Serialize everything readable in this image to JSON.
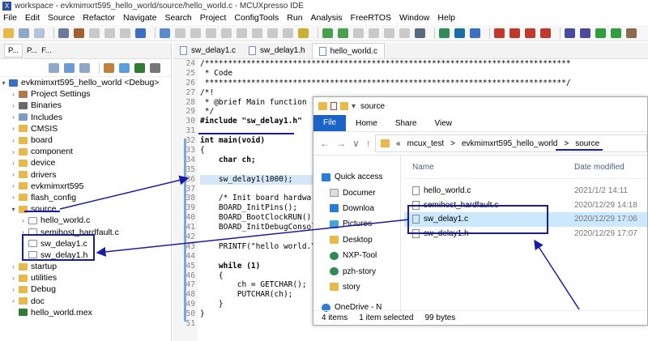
{
  "window": {
    "title": "workspace - evkmimxrt595_hello_world/source/hello_world.c - MCUXpresso IDE"
  },
  "menu": [
    "File",
    "Edit",
    "Source",
    "Refactor",
    "Navigate",
    "Search",
    "Project",
    "ConfigTools",
    "Run",
    "Analysis",
    "FreeRTOS",
    "Window",
    "Help"
  ],
  "left_tabs": [
    "P...",
    "P...",
    "F..."
  ],
  "tree": {
    "project": "evkmimxrt595_hello_world <Debug>",
    "items": [
      {
        "label": "Project Settings",
        "kind": "settings"
      },
      {
        "label": "Binaries",
        "kind": "binaries"
      },
      {
        "label": "Includes",
        "kind": "includes"
      },
      {
        "label": "CMSIS",
        "kind": "folder"
      },
      {
        "label": "board",
        "kind": "folder"
      },
      {
        "label": "component",
        "kind": "folder"
      },
      {
        "label": "device",
        "kind": "folder"
      },
      {
        "label": "drivers",
        "kind": "folder"
      },
      {
        "label": "evkmimxrt595",
        "kind": "folder"
      },
      {
        "label": "flash_config",
        "kind": "folder"
      },
      {
        "label": "source",
        "kind": "folder-open"
      },
      {
        "label": "hello_world.c",
        "kind": "c-file"
      },
      {
        "label": "semihost_hardfault.c",
        "kind": "c-file"
      },
      {
        "label": "sw_delay1.c",
        "kind": "c-file"
      },
      {
        "label": "sw_delay1.h",
        "kind": "h-file"
      },
      {
        "label": "startup",
        "kind": "folder"
      },
      {
        "label": "utilities",
        "kind": "folder"
      },
      {
        "label": "Debug",
        "kind": "folder"
      },
      {
        "label": "doc",
        "kind": "folder"
      },
      {
        "label": "hello_world.mex",
        "kind": "mex"
      }
    ]
  },
  "editor_tabs": [
    "sw_delay1.c",
    "sw_delay1.h",
    "hello_world.c"
  ],
  "code": {
    "line_numbers": [
      "24",
      "25",
      "26",
      "27",
      "28",
      "29",
      "30",
      "31",
      "32",
      "33",
      "34",
      "35",
      "36",
      "37",
      "38",
      "39",
      "40",
      "41",
      "42",
      "43",
      "44",
      "45",
      "46",
      "47",
      "48",
      "49",
      "50",
      "51"
    ],
    "lines": [
      "/*******************************************************************************",
      " * Code",
      " ******************************************************************************/",
      "/*!",
      " * @brief Main function",
      " */",
      "#include \"sw_delay1.h\"",
      "",
      "int main(void)",
      "{",
      "    char ch;",
      "",
      "    sw_delay1(1000);",
      "",
      "    /* Init board hardware. */",
      "    BOARD_InitPins();",
      "    BOARD_BootClockRUN();",
      "    BOARD_InitDebugConsole();",
      "",
      "    PRINTF(\"hello world.\\r\\n\");",
      "",
      "    while (1)",
      "    {",
      "        ch = GETCHAR();",
      "        PUTCHAR(ch);",
      "    }",
      "}",
      ""
    ]
  },
  "explorer": {
    "title": "source",
    "ribbon": [
      "File",
      "Home",
      "Share",
      "View"
    ],
    "breadcrumb": [
      "«",
      "mcux_test",
      ">",
      "evkmimxrt595_hello_world",
      ">",
      "source"
    ],
    "nav": [
      "Quick access",
      "Documer",
      "Downloa",
      "Pictures",
      "Desktop",
      "NXP-Tool",
      "pzh-story",
      "story",
      "OneDrive - N"
    ],
    "columns": [
      "Name",
      "Date modified"
    ],
    "files": [
      {
        "name": "hello_world.c",
        "date": "2021/1/2 14:11"
      },
      {
        "name": "semihost_hardfault.c",
        "date": "2020/12/29 14:18"
      },
      {
        "name": "sw_delay1.c",
        "date": "2020/12/29 17:06"
      },
      {
        "name": "sw_delay1.h",
        "date": "2020/12/29 17:07"
      }
    ],
    "status": [
      "4 items",
      "1 item selected",
      "99 bytes"
    ]
  }
}
